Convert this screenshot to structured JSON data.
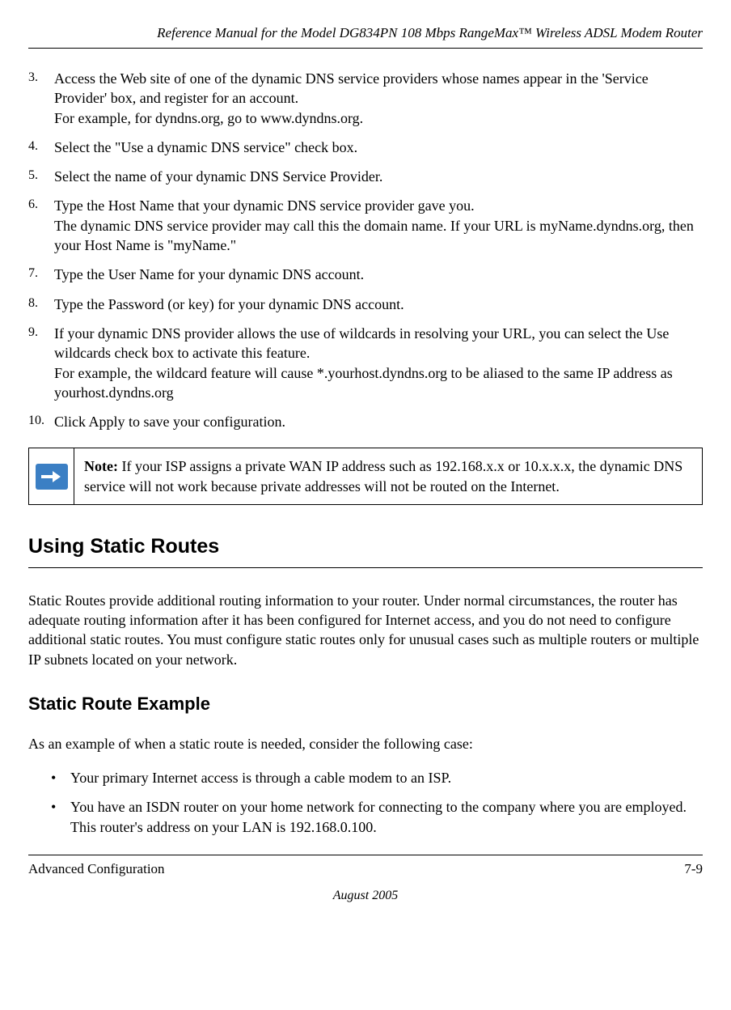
{
  "header": {
    "title": "Reference Manual for the Model DG834PN 108 Mbps RangeMax™ Wireless ADSL Modem Router"
  },
  "steps": [
    {
      "num": "3.",
      "text": "Access the Web site of one of the dynamic DNS service providers whose names appear in the 'Service Provider' box, and register for an account.\nFor example, for dyndns.org, go to www.dyndns.org."
    },
    {
      "num": "4.",
      "text": "Select the \"Use a dynamic DNS service\" check box."
    },
    {
      "num": "5.",
      "text": "Select the name of your dynamic DNS Service Provider."
    },
    {
      "num": "6.",
      "text": "Type the Host Name that your dynamic DNS service provider gave you.\nThe dynamic DNS service provider may call this the domain name. If your URL is myName.dyndns.org, then your Host Name is \"myName.\""
    },
    {
      "num": "7.",
      "text": "Type the User Name for your dynamic DNS account."
    },
    {
      "num": "8.",
      "text": "Type the Password (or key) for your dynamic DNS account."
    },
    {
      "num": "9.",
      "text": "If your dynamic DNS provider allows the use of wildcards in resolving your URL, you can select the Use wildcards check box to activate this feature.\nFor example, the wildcard feature will cause *.yourhost.dyndns.org to be aliased to the same IP address as yourhost.dyndns.org"
    },
    {
      "num": "10.",
      "text": "Click Apply to save your configuration."
    }
  ],
  "note": {
    "label": "Note:",
    "text": " If your ISP assigns a private WAN IP address such as 192.168.x.x or 10.x.x.x, the dynamic DNS service will not work because private addresses will not be routed on the Internet."
  },
  "section": {
    "title": "Using Static Routes",
    "para": "Static Routes provide additional routing information to your router. Under normal circumstances, the router has adequate routing information after it has been configured for Internet access, and you do not need to configure additional static routes. You must configure static routes only for unusual cases such as multiple routers or multiple IP subnets located on your network."
  },
  "subsection": {
    "title": "Static Route Example",
    "intro": "As an example of when a static route is needed, consider the following case:",
    "bullets": [
      "Your primary Internet access is through a cable modem to an ISP.",
      "You have an ISDN router on your home network for connecting to the company where you are employed. This router's address on your LAN is 192.168.0.100."
    ]
  },
  "footer": {
    "left": "Advanced Configuration",
    "right": "7-9",
    "date": "August 2005"
  }
}
